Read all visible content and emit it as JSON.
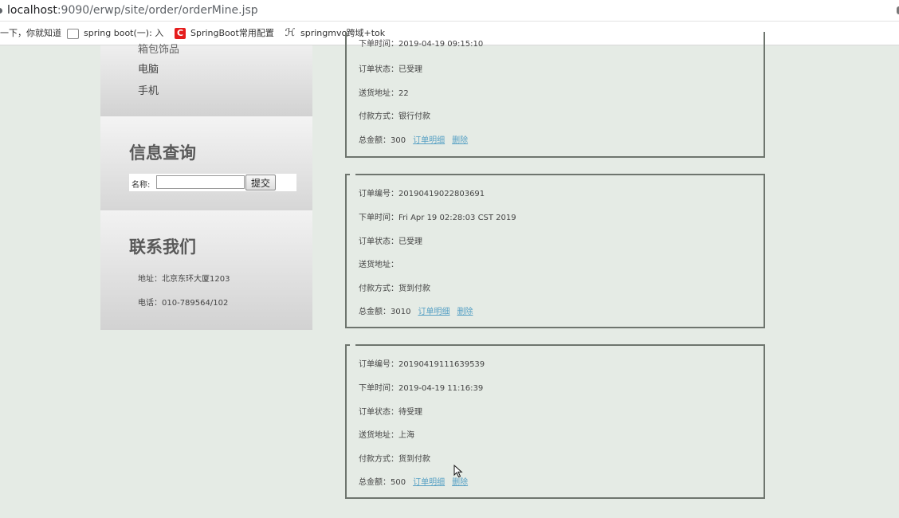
{
  "browser": {
    "url_host": "localhost",
    "url_path": ":9090/erwp/site/order/orderMine.jsp",
    "bookmarks": [
      {
        "label": "一下，你就知道",
        "icon": "baidu-icon"
      },
      {
        "label": "spring boot(一): 入",
        "icon": "page-icon"
      },
      {
        "label": "SpringBoot常用配置",
        "icon": "csdn-icon"
      },
      {
        "label": "springmvc跨域+tok",
        "icon": "link-icon"
      }
    ]
  },
  "sidebar": {
    "categories": [
      "箱包饰品",
      "电脑",
      "手机"
    ],
    "search": {
      "title": "信息查询",
      "label": "名称:",
      "value": "",
      "button": "提交"
    },
    "contact": {
      "title": "联系我们",
      "address": "地址：北京东环大厦1203",
      "phone": "电话：010-789564/102"
    }
  },
  "orders": [
    {
      "time": "下单时间：2019-04-19 09:15:10",
      "status": "订单状态：已受理",
      "address": "送货地址：22",
      "payment": "付款方式：银行付款",
      "total": "总金额：300",
      "detail_link": "订单明细",
      "delete_link": "删除"
    },
    {
      "number": "订单编号：20190419022803691",
      "time": "下单时间：Fri Apr 19 02:28:03 CST 2019",
      "status": "订单状态：已受理",
      "address": "送货地址：",
      "payment": "付款方式：货到付款",
      "total": "总金额：3010",
      "detail_link": "订单明细",
      "delete_link": "删除"
    },
    {
      "number": "订单编号：20190419111639539",
      "time": "下单时间：2019-04-19 11:16:39",
      "status": "订单状态：待受理",
      "address": "送货地址：上海",
      "payment": "付款方式：货到付款",
      "total": "总金额：500",
      "detail_link": "订单明细",
      "delete_link": "删除"
    }
  ]
}
